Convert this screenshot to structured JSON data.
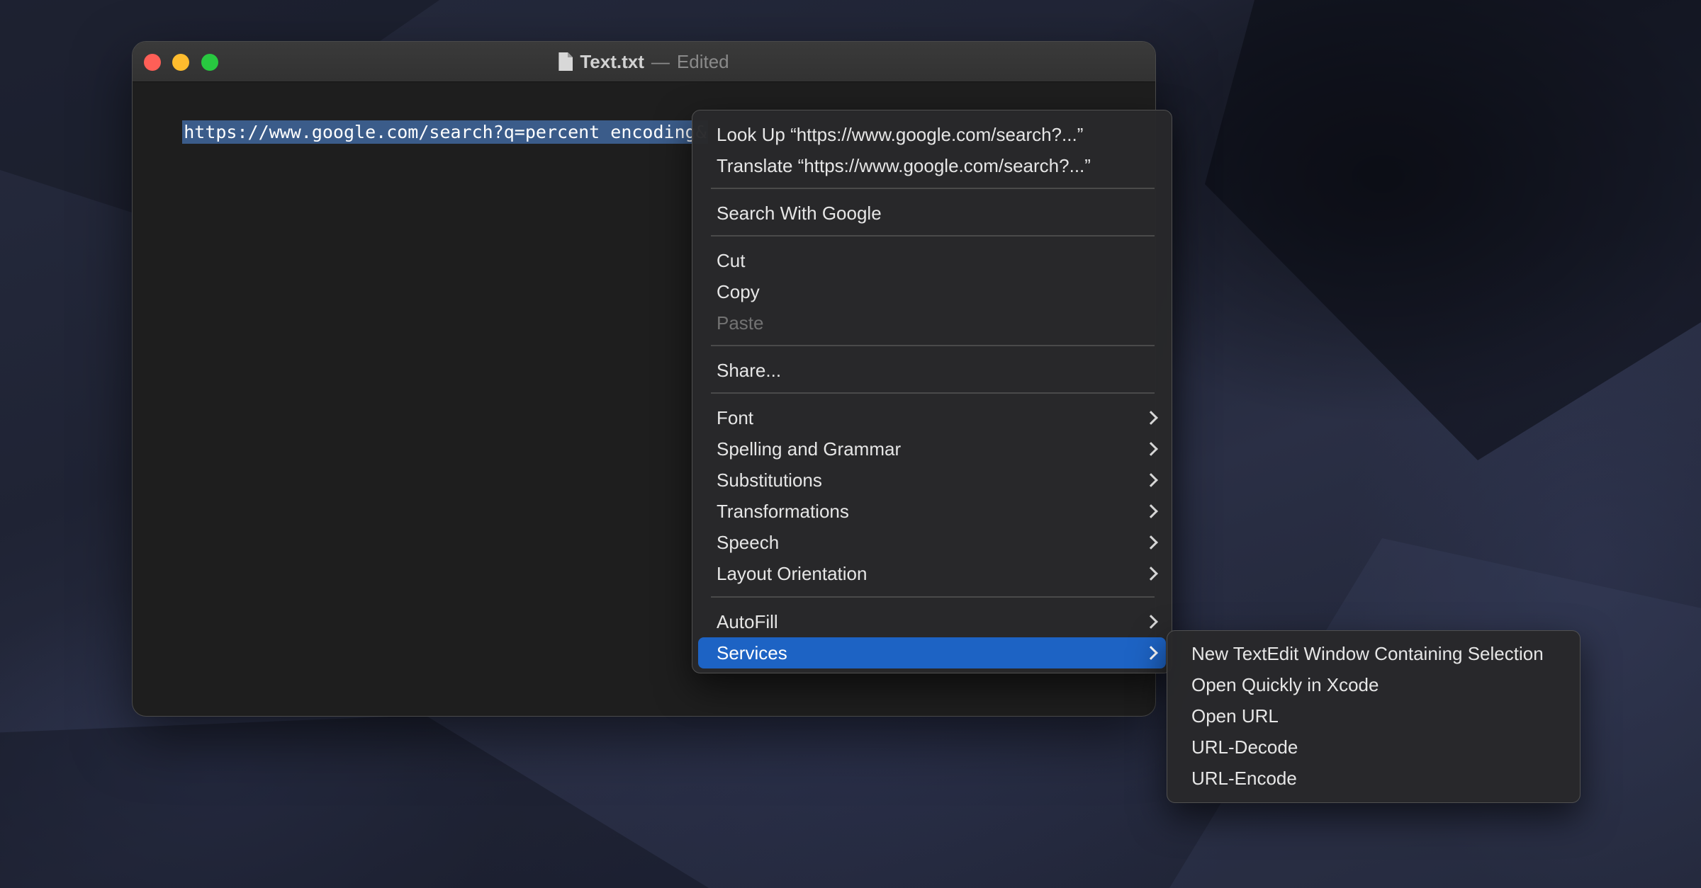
{
  "window": {
    "title": "Text.txt",
    "title_separator": "—",
    "status": "Edited",
    "document_icon": "document-icon"
  },
  "editor": {
    "visible_text": "https://www.google.com/search?q=percent encoding&"
  },
  "context_menu": {
    "items": [
      {
        "label": "Look Up “https://www.google.com/search?...”"
      },
      {
        "label": "Translate “https://www.google.com/search?...”"
      },
      {
        "label": "Search With Google"
      },
      {
        "label": "Cut"
      },
      {
        "label": "Copy"
      },
      {
        "label": "Paste",
        "disabled": true
      },
      {
        "label": "Share..."
      },
      {
        "label": "Font",
        "submenu": true
      },
      {
        "label": "Spelling and Grammar",
        "submenu": true
      },
      {
        "label": "Substitutions",
        "submenu": true
      },
      {
        "label": "Transformations",
        "submenu": true
      },
      {
        "label": "Speech",
        "submenu": true
      },
      {
        "label": "Layout Orientation",
        "submenu": true
      },
      {
        "label": "AutoFill",
        "submenu": true
      },
      {
        "label": "Services",
        "submenu": true,
        "highlighted": true
      }
    ]
  },
  "services_submenu": {
    "items": [
      {
        "label": "New TextEdit Window Containing Selection"
      },
      {
        "label": "Open Quickly in Xcode"
      },
      {
        "label": "Open URL"
      },
      {
        "label": "URL-Decode"
      },
      {
        "label": "URL-Encode"
      }
    ]
  },
  "colors": {
    "highlight": "#1d63c4",
    "selection": "#3b5c8a",
    "close": "#ff5f57",
    "minimize": "#febc2e",
    "zoom": "#28c840"
  }
}
